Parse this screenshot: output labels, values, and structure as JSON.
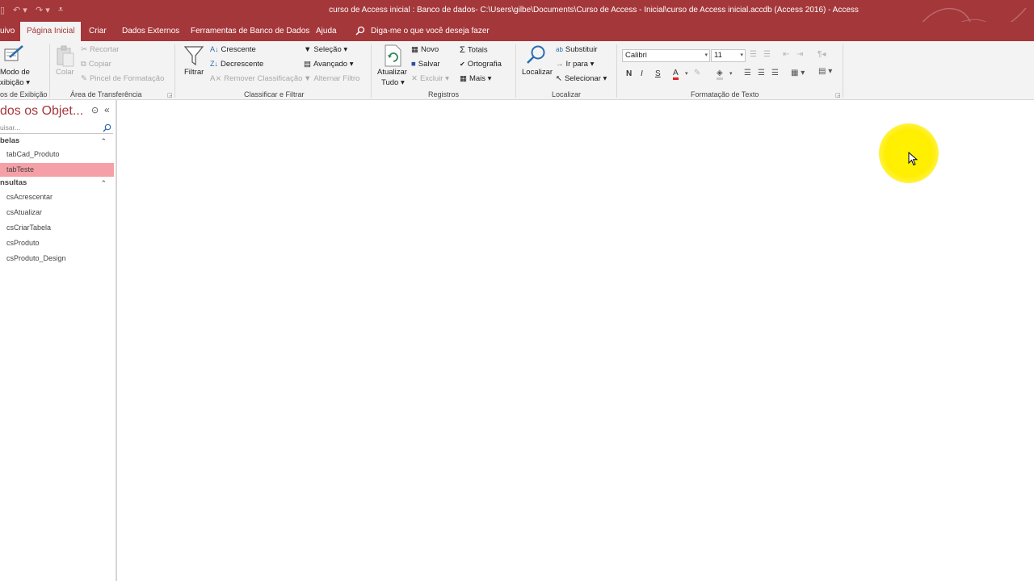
{
  "titlebar": {
    "title": "curso de Access inicial : Banco de dados- C:\\Users\\gilbe\\Documents\\Curso de Access - Inicial\\curso de Access inicial.accdb (Access 2016)  -  Access",
    "color": "#a4373a"
  },
  "tabs": {
    "file": "uivo",
    "home": "Página Inicial",
    "create": "Criar",
    "external": "Dados Externos",
    "dbtools": "Ferramentas de Banco de Dados",
    "help": "Ajuda",
    "tellme": "Diga-me o que você deseja fazer"
  },
  "ribbon": {
    "views": {
      "btn_line1": "Modo de",
      "btn_line2": "xibição",
      "label": "os de Exibição"
    },
    "clipboard": {
      "paste": "Colar",
      "cut": "Recortar",
      "copy": "Copiar",
      "format_painter": "Pincel de Formatação",
      "label": "Área de Transferência"
    },
    "sort": {
      "filter": "Filtrar",
      "ascending": "Crescente",
      "descending": "Decrescente",
      "remove_sort": "Remover Classificação",
      "selection": "Seleção",
      "advanced": "Avançado",
      "toggle_filter": "Alternar Filtro",
      "label": "Classificar e Filtrar"
    },
    "records": {
      "refresh_line1": "Atualizar",
      "refresh_line2": "Tudo",
      "new": "Novo",
      "save": "Salvar",
      "delete": "Excluir",
      "totals": "Totais",
      "spelling": "Ortografia",
      "more": "Mais",
      "label": "Registros"
    },
    "find": {
      "find": "Localizar",
      "replace": "Substituir",
      "goto": "Ir para",
      "select": "Selecionar",
      "label": "Localizar"
    },
    "text": {
      "font": "Calibri",
      "size": "11",
      "bold": "N",
      "italic": "I",
      "underline": "S",
      "label": "Formatação de Texto"
    }
  },
  "nav": {
    "title": "dos os Objet...",
    "search_placeholder": "uisar...",
    "groups": [
      {
        "name": "belas",
        "items": [
          "tabCad_Produto",
          "tabTeste"
        ]
      },
      {
        "name": "nsultas",
        "items": [
          "csAcrescentar",
          "csAtualizar",
          "csCriarTabela",
          "csProduto",
          "csProduto_Design"
        ]
      }
    ],
    "selected": "tabTeste"
  }
}
